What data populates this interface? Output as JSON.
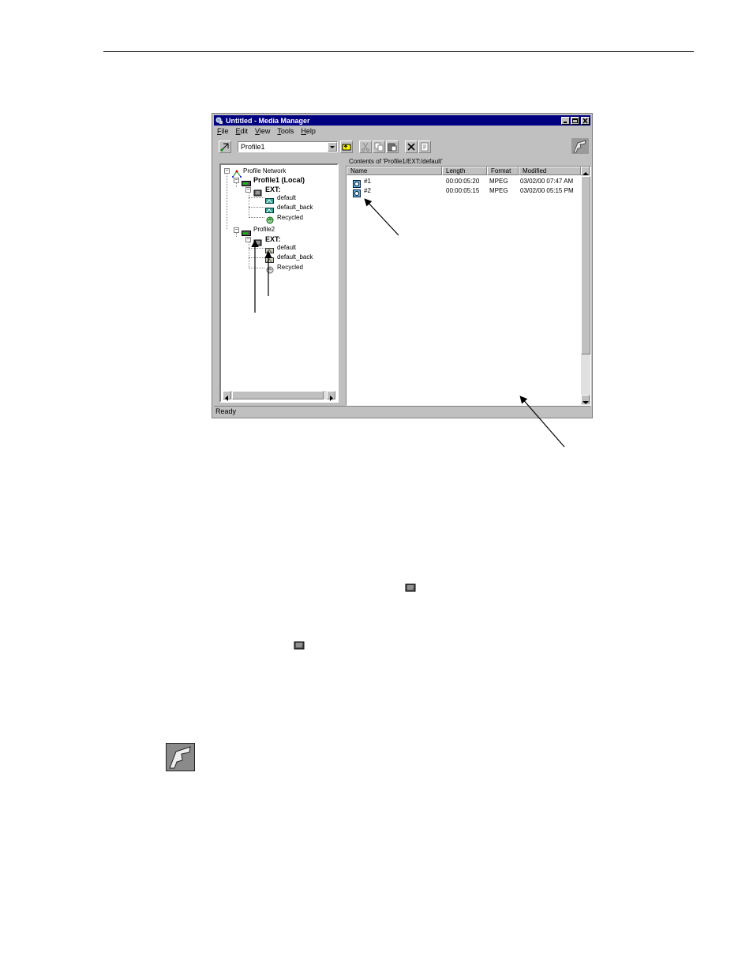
{
  "window": {
    "title": "Untitled - Media Manager",
    "status": "Ready",
    "menu": [
      {
        "label": "File",
        "key": "F",
        "rest": "ile"
      },
      {
        "label": "Edit",
        "key": "E",
        "rest": "dit"
      },
      {
        "label": "View",
        "key": "V",
        "rest": "iew"
      },
      {
        "label": "Tools",
        "key": "T",
        "rest": "ools"
      },
      {
        "label": "Help",
        "key": "H",
        "rest": "elp"
      }
    ],
    "toolbar": {
      "combo_value": "Profile1"
    }
  },
  "tree": {
    "root": "Profile Network",
    "profile1": "Profile1 (Local)",
    "profile1_ext": "EXT:",
    "profile1_bins": [
      "default",
      "default_back",
      "Recycled"
    ],
    "profile2": "Profile2",
    "profile2_ext": "EXT:",
    "profile2_bins": [
      "default",
      "default_back",
      "Recycled"
    ]
  },
  "list": {
    "caption": "Contents of 'Profile1/EXT:/default'",
    "columns": [
      "Name",
      "Length",
      "Format",
      "Modified"
    ],
    "rows": [
      {
        "name": "#1",
        "length": "00:00:05:20",
        "format": "MPEG",
        "modified": "03/02/00 07:47 AM"
      },
      {
        "name": "#2",
        "length": "00:00:05:15",
        "format": "MPEG",
        "modified": "03/02/00 05:15 PM"
      }
    ]
  },
  "icons": {
    "title": "media-manager-icon",
    "disk": "disk-volume-icon",
    "bin": "bin-icon",
    "clip": "clip-icon",
    "logo": "profile-logo-icon"
  }
}
